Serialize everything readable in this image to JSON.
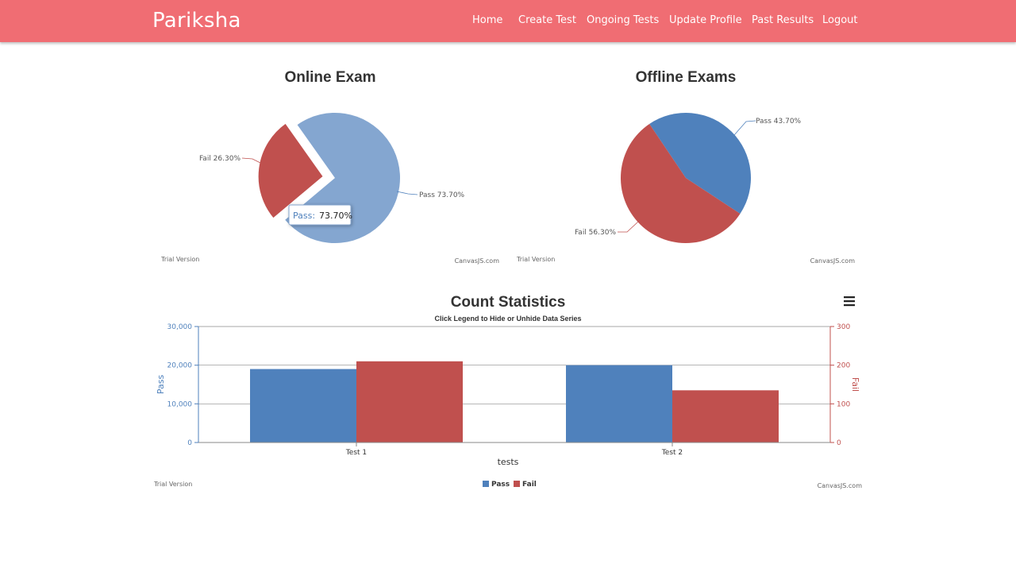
{
  "navbar": {
    "brand": "Pariksha",
    "links": [
      "Home",
      "Create Test",
      "Ongoing Tests",
      "Update Profile",
      "Past Results",
      "Logout"
    ]
  },
  "colors": {
    "navbar": "#f06d73",
    "pass": "#4f81bc",
    "pass_light": "#84a6d0",
    "fail": "#c0504e"
  },
  "watermarks": {
    "trial": "Trial Version",
    "credit": "CanvasJS.com"
  },
  "chart_data": [
    {
      "type": "pie",
      "title": "Online Exam",
      "slices": [
        {
          "label": "Pass",
          "value": 73.7,
          "text": "Pass 73.70%"
        },
        {
          "label": "Fail",
          "value": 26.3,
          "text": "Fail 26.30%",
          "exploded": true
        }
      ],
      "tooltip": {
        "label": "Pass:",
        "value": "73.70%"
      }
    },
    {
      "type": "pie",
      "title": "Offline Exams",
      "slices": [
        {
          "label": "Pass",
          "value": 43.7,
          "text": "Pass 43.70%"
        },
        {
          "label": "Fail",
          "value": 56.3,
          "text": "Fail 56.30%"
        }
      ]
    },
    {
      "type": "bar",
      "title": "Count Statistics",
      "subtitle": "Click Legend to Hide or Unhide Data Series",
      "categories": [
        "Test 1",
        "Test 2"
      ],
      "xlabel": "tests",
      "ylabel": "Pass",
      "y2label": "Fail",
      "ylim": [
        0,
        30000
      ],
      "y2lim": [
        0,
        300
      ],
      "yticks": [
        "0",
        "10,000",
        "20,000",
        "30,000"
      ],
      "y2ticks": [
        "0",
        "100",
        "200",
        "300"
      ],
      "grid": true,
      "legend_placement": "bottom",
      "series": [
        {
          "name": "Pass",
          "axis": "primary",
          "values": [
            19000,
            20000
          ]
        },
        {
          "name": "Fail",
          "axis": "secondary",
          "values": [
            210,
            135
          ]
        }
      ]
    }
  ]
}
